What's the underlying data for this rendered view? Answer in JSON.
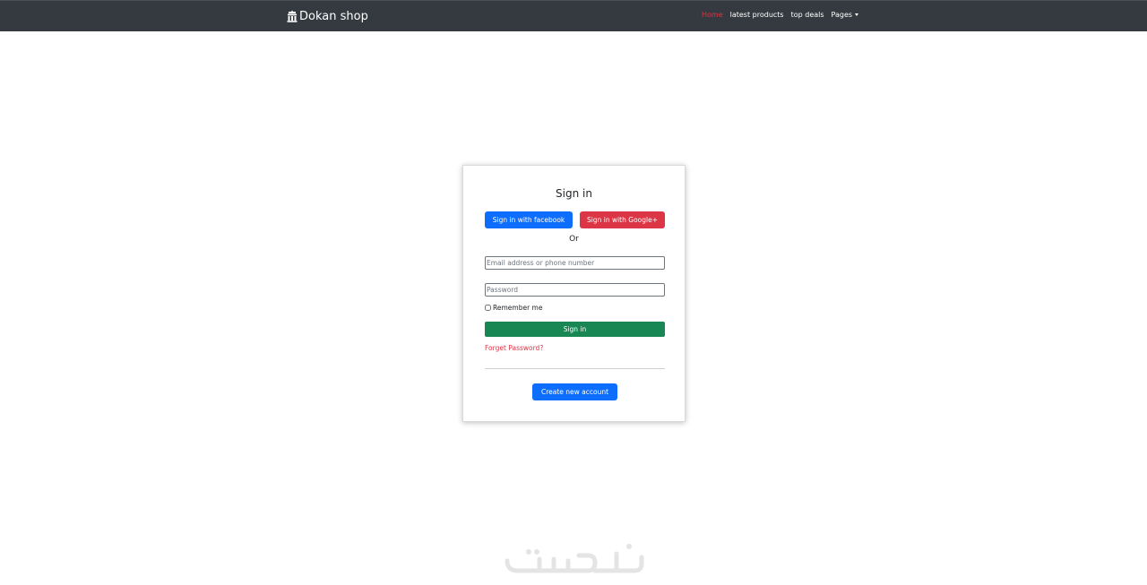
{
  "navbar": {
    "brand": "Dokan shop",
    "brand_icon": "shop-icon",
    "links": [
      {
        "label": "Home",
        "active": true
      },
      {
        "label": "latest products"
      },
      {
        "label": "top deals"
      },
      {
        "label": "Pages",
        "dropdown": true
      }
    ]
  },
  "signin": {
    "title": "Sign in",
    "facebook_button": "Sign in with facebook",
    "google_button": "Sign in with Google+",
    "or_text": "Or",
    "email_placeholder": "Email address or phone number",
    "password_placeholder": "Password",
    "remember_label": "Remember me",
    "submit_button": "Sign in",
    "forgot_link": "Forget Password?",
    "create_account_button": "Create new account"
  },
  "watermark": {
    "icon": "khamsat-logo",
    "text": "خمسات"
  },
  "colors": {
    "navbar_bg": "#343a40",
    "primary": "#0d6efd",
    "danger": "#dc3545",
    "success": "#198754"
  }
}
